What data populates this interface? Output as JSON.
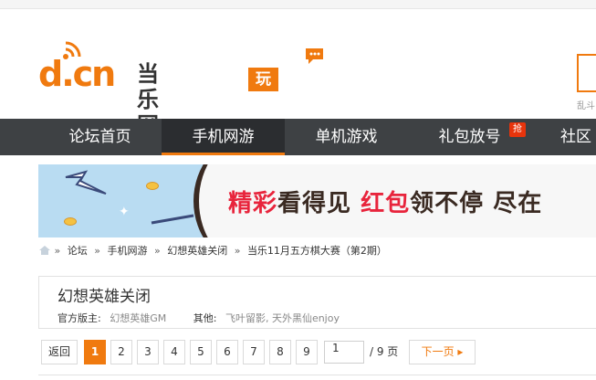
{
  "header": {
    "logo_domain": "d.cn",
    "logo_name": "当乐网",
    "logo_badge": "玩家社区",
    "search_hint": "乱斗",
    "brand_color": "#f07a0f"
  },
  "nav": {
    "items": [
      {
        "label": "论坛首页"
      },
      {
        "label": "手机网游"
      },
      {
        "label": "单机游戏"
      },
      {
        "label": "礼包放号",
        "badge": "抢"
      },
      {
        "label": "社区"
      }
    ]
  },
  "banner": {
    "text_a": "精彩",
    "text_b": "看得见",
    "text_c": "红包",
    "text_d": "领不停",
    "text_e": "尽在"
  },
  "breadcrumb": {
    "items": [
      "论坛",
      "手机网游",
      "幻想英雄关闭",
      "当乐11月五方棋大赛（第2期）"
    ],
    "separator": "»"
  },
  "thread": {
    "title": "幻想英雄关闭",
    "moderator_label": "官方版主:",
    "moderator_value": "幻想英雄GM",
    "other_label": "其他:",
    "other_value": "飞叶留影, 天外黑仙enjoy"
  },
  "pager": {
    "back_label": "返回",
    "pages": [
      "1",
      "2",
      "3",
      "4",
      "5",
      "6",
      "7",
      "8",
      "9"
    ],
    "current_input": "1",
    "total_label": "/ 9 页",
    "next_label": "下一页 ▸"
  }
}
